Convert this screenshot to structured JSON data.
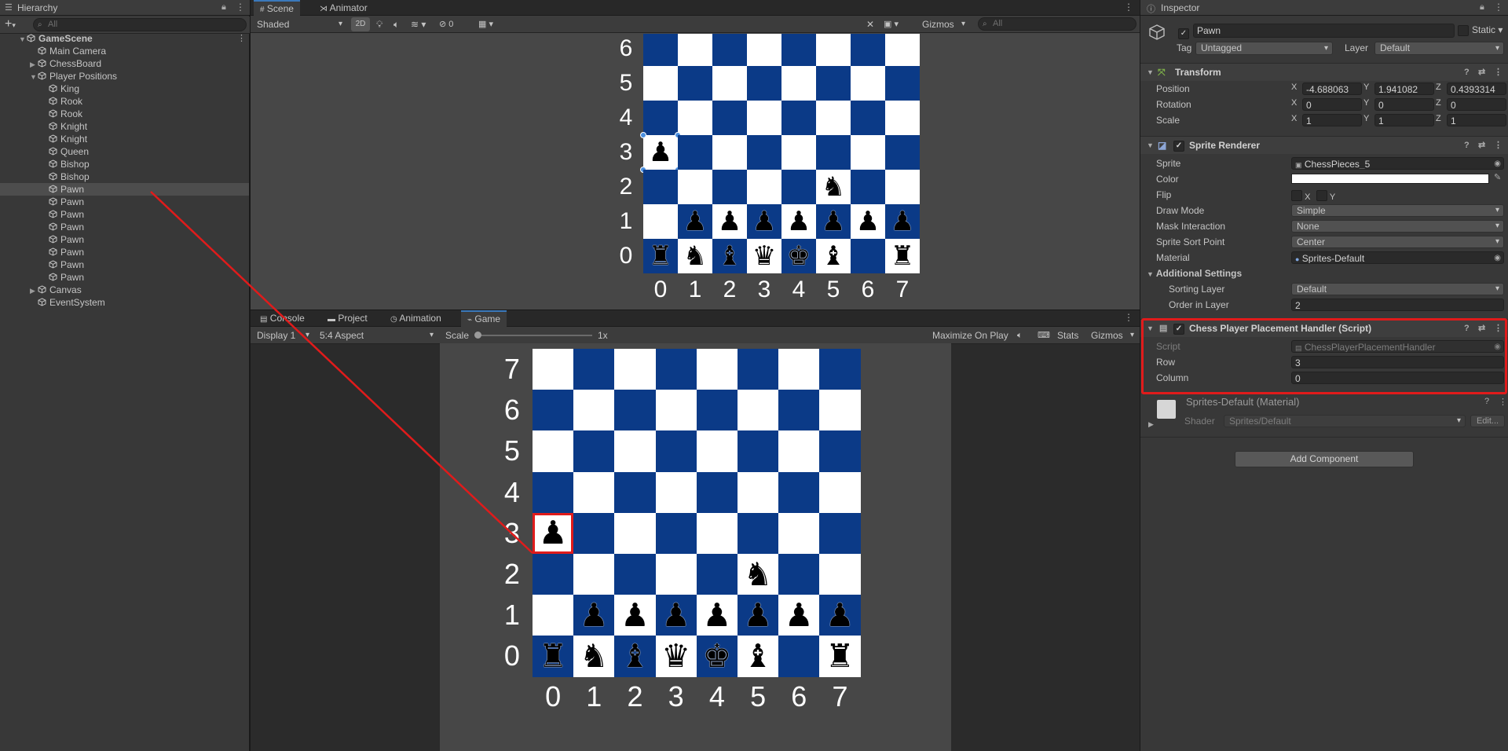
{
  "hierarchy": {
    "tab_label": "Hierarchy",
    "add_label": "+",
    "search_placeholder": "All",
    "items": [
      {
        "label": "GameScene"
      },
      {
        "label": "Main Camera"
      },
      {
        "label": "ChessBoard"
      },
      {
        "label": "Player Positions"
      },
      {
        "label": "King"
      },
      {
        "label": "Rook"
      },
      {
        "label": "Rook"
      },
      {
        "label": "Knight"
      },
      {
        "label": "Knight"
      },
      {
        "label": "Queen"
      },
      {
        "label": "Bishop"
      },
      {
        "label": "Bishop"
      },
      {
        "label": "Pawn"
      },
      {
        "label": "Pawn"
      },
      {
        "label": "Pawn"
      },
      {
        "label": "Pawn"
      },
      {
        "label": "Pawn"
      },
      {
        "label": "Pawn"
      },
      {
        "label": "Pawn"
      },
      {
        "label": "Pawn"
      },
      {
        "label": "Canvas"
      },
      {
        "label": "EventSystem"
      }
    ]
  },
  "scene": {
    "tabs": [
      "Scene",
      "Animator"
    ],
    "shading": "Shaded",
    "mode_2d": "2D",
    "hidden_count": "0",
    "gizmos": "Gizmos",
    "search_placeholder": "All",
    "rows_visible": [
      "6",
      "5",
      "4",
      "3",
      "2",
      "1",
      "0"
    ],
    "cols": [
      "0",
      "1",
      "2",
      "3",
      "4",
      "5",
      "6",
      "7"
    ]
  },
  "game": {
    "tabs": [
      "Console",
      "Project",
      "Animation",
      "Game"
    ],
    "display": "Display 1",
    "aspect": "5:4 Aspect",
    "scale_label": "Scale",
    "scale_value": "1x",
    "maximize": "Maximize On Play",
    "stats": "Stats",
    "gizmos": "Gizmos",
    "rows": [
      "7",
      "6",
      "5",
      "4",
      "3",
      "2",
      "1",
      "0"
    ],
    "cols": [
      "0",
      "1",
      "2",
      "3",
      "4",
      "5",
      "6",
      "7"
    ]
  },
  "board": {
    "dark_color": "#0b3a87",
    "light_color": "#ffffff",
    "highlight_color": "#e01b1b",
    "pieces": [
      {
        "row": 0,
        "col": 0,
        "glyph": "♜"
      },
      {
        "row": 0,
        "col": 1,
        "glyph": "♞"
      },
      {
        "row": 0,
        "col": 2,
        "glyph": "♝"
      },
      {
        "row": 0,
        "col": 3,
        "glyph": "♛"
      },
      {
        "row": 0,
        "col": 4,
        "glyph": "♚"
      },
      {
        "row": 0,
        "col": 5,
        "glyph": "♝"
      },
      {
        "row": 0,
        "col": 7,
        "glyph": "♜"
      },
      {
        "row": 1,
        "col": 1,
        "glyph": "♟"
      },
      {
        "row": 1,
        "col": 2,
        "glyph": "♟"
      },
      {
        "row": 1,
        "col": 3,
        "glyph": "♟"
      },
      {
        "row": 1,
        "col": 4,
        "glyph": "♟"
      },
      {
        "row": 1,
        "col": 5,
        "glyph": "♟"
      },
      {
        "row": 1,
        "col": 6,
        "glyph": "♟"
      },
      {
        "row": 1,
        "col": 7,
        "glyph": "♟"
      },
      {
        "row": 2,
        "col": 5,
        "glyph": "♞"
      },
      {
        "row": 3,
        "col": 0,
        "glyph": "♟"
      }
    ]
  },
  "inspector": {
    "tab_label": "Inspector",
    "object_name": "Pawn",
    "static_label": "Static",
    "tag_label": "Tag",
    "tag_value": "Untagged",
    "layer_label": "Layer",
    "layer_value": "Default",
    "transform": {
      "title": "Transform",
      "position_label": "Position",
      "rotation_label": "Rotation",
      "scale_label": "Scale",
      "position": [
        "-4.688063",
        "1.941082",
        "0.4393314"
      ],
      "rotation": [
        "0",
        "0",
        "0"
      ],
      "scale": [
        "1",
        "1",
        "1"
      ],
      "axis": [
        "X",
        "Y",
        "Z"
      ]
    },
    "sprite_renderer": {
      "title": "Sprite Renderer",
      "sprite_label": "Sprite",
      "sprite_value": "ChessPieces_5",
      "color_label": "Color",
      "flip_label": "Flip",
      "flip_x": "X",
      "flip_y": "Y",
      "draw_mode_label": "Draw Mode",
      "draw_mode_value": "Simple",
      "mask_label": "Mask Interaction",
      "mask_value": "None",
      "sort_point_label": "Sprite Sort Point",
      "sort_point_value": "Center",
      "material_label": "Material",
      "material_value": "Sprites-Default",
      "additional_label": "Additional Settings",
      "sorting_layer_label": "Sorting Layer",
      "sorting_layer_value": "Default",
      "order_label": "Order in Layer",
      "order_value": "2"
    },
    "script_comp": {
      "title": "Chess Player Placement Handler (Script)",
      "script_label": "Script",
      "script_value": "ChessPlayerPlacementHandler",
      "row_label": "Row",
      "row_value": "3",
      "column_label": "Column",
      "column_value": "0"
    },
    "material": {
      "name": "Sprites-Default (Material)",
      "shader_label": "Shader",
      "shader_value": "Sprites/Default",
      "edit_label": "Edit..."
    },
    "add_component": "Add Component"
  }
}
